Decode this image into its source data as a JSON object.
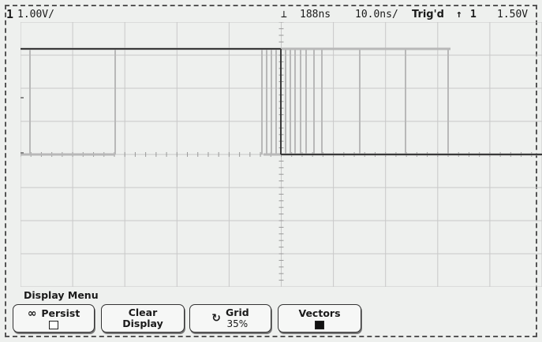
{
  "status_bar": {
    "channel_number": "1",
    "channel_scale": "1.00V/",
    "trigger_marker": "⊥",
    "time_delay": "188ns",
    "time_scale": "10.0ns/",
    "trigger_status": "Trig'd",
    "trigger_edge": "↑",
    "trigger_source": "1",
    "trigger_level": "1.50V"
  },
  "display": {
    "trace_color": "#3a3a3a",
    "persist_color": "#b8b8b8",
    "grid_color": "#c8c8c8",
    "background": "#eef0ee"
  },
  "menu": {
    "title": "Display Menu",
    "softkeys": {
      "persist": {
        "icon": "infinity-icon",
        "label": "Persist"
      },
      "clear": {
        "line1": "Clear",
        "line2": "Display"
      },
      "grid": {
        "icon": "rotate-icon",
        "label": "Grid",
        "value": "35%"
      },
      "vectors": {
        "label": "Vectors"
      }
    }
  }
}
